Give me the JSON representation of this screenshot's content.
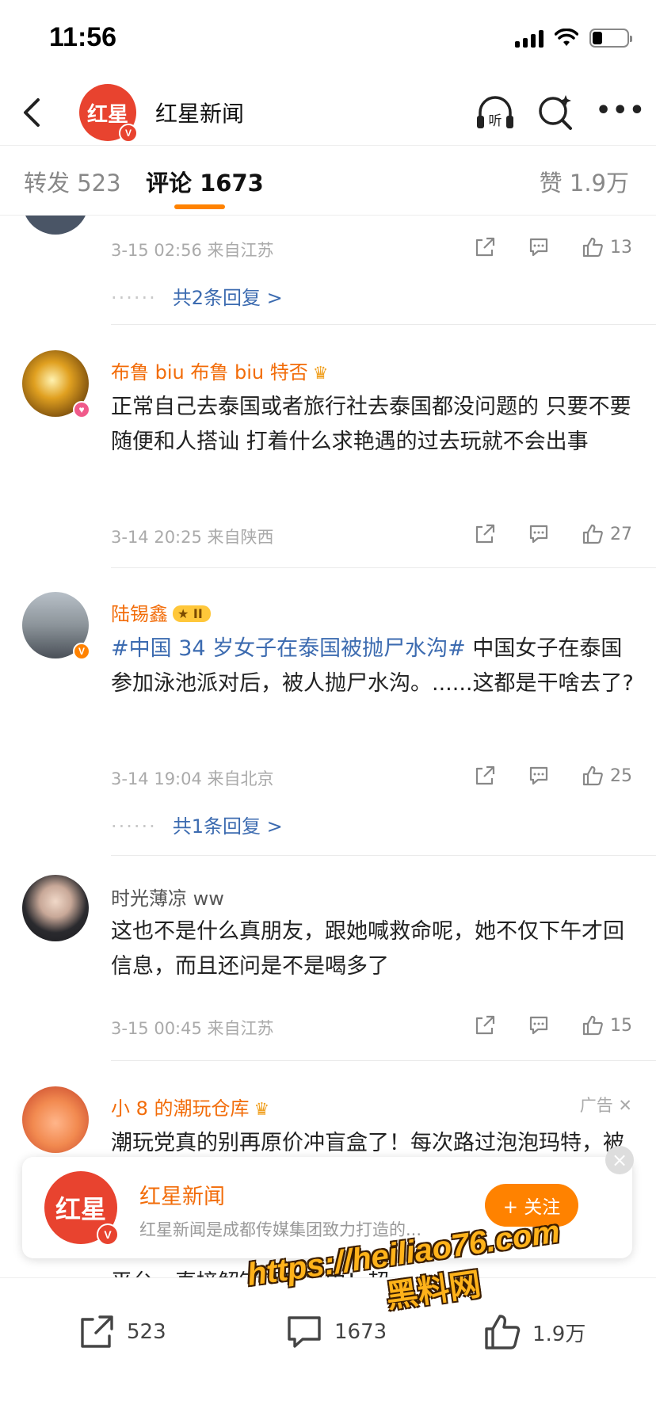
{
  "status_bar": {
    "time": "11:56"
  },
  "nav": {
    "title": "红星新闻",
    "avatar_text": "红星",
    "v_badge": "V"
  },
  "tabs": {
    "repost": "转发 523",
    "comment": "评论 1673",
    "like": "赞 1.9万"
  },
  "accent_color": "#ff8200",
  "comments": [
    {
      "meta": "3-15 02:56 来自江苏",
      "likes": "13",
      "replies": "共2条回复 >",
      "reply_dots": "······"
    },
    {
      "username": "布鲁 biu 布鲁 biu 特否",
      "badge_icon": "crown-icon",
      "text": "正常自己去泰国或者旅行社去泰国都没问题的 只要不要随便和人搭讪 打着什么求艳遇的过去玩就不会出事",
      "meta": "3-14 20:25 来自陕西",
      "likes": "27"
    },
    {
      "username": "陆锡鑫",
      "vip_badge": "II",
      "topic": "#中国 34 岁女子在泰国被抛尸水沟#",
      "text": " 中国女子在泰国参加泳池派对后，被人抛尸水沟。......这都是干啥去了?",
      "meta": "3-14 19:04 来自北京",
      "likes": "25",
      "replies": "共1条回复 >",
      "reply_dots": "······"
    },
    {
      "username": "时光薄凉 ww",
      "text": "这也不是什么真朋友，跟她喊救命呢，她不仅下午才回信息，而且还问是不是喝多了",
      "meta": "3-15 00:45 来自江苏",
      "likes": "15"
    },
    {
      "username": "小 8 的潮玩仓库",
      "ad_label": "广告",
      "text": "潮玩党真的别再原价冲盲盒了！每次路过泡泡玛特，被可爱的拉布布勾得走不动道，可一百多块抽一次是真肉疼，钱包根本扛不住，开出重复款堆家里占地方，扔了舍不得留着闹心，谁懂这种苦！直到挖到闲鱼这个宝藏平台，直接解锁潮玩自由！超"
    }
  ],
  "follow_card": {
    "name": "红星新闻",
    "avatar_text": "红星",
    "description": "红星新闻是成都传媒集团致力打造的...",
    "follow_label": "+ 关注",
    "close": "×"
  },
  "bottom_bar": {
    "repost": "523",
    "comment": "1673",
    "like": "1.9万"
  },
  "watermark": {
    "url": "https://heiliao76.com",
    "cn": "黑料网"
  }
}
